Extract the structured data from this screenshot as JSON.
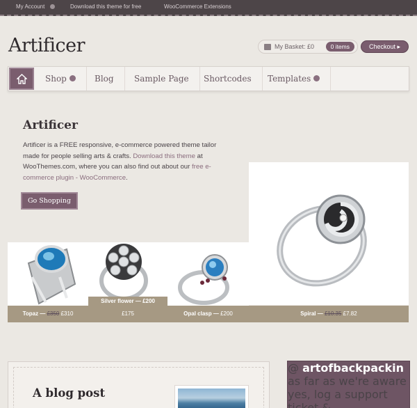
{
  "topbar": {
    "links": [
      "My Account",
      "Download this theme for free",
      "WooCommerce Extensions"
    ]
  },
  "header": {
    "site_title": "Artificer",
    "basket_label": "My Basket: £0",
    "basket_items": "0 items",
    "checkout_label": "Checkout ▸"
  },
  "nav": {
    "items": [
      {
        "label": "Shop",
        "dropdown": true
      },
      {
        "label": "Blog",
        "dropdown": false
      },
      {
        "label": "Sample Page",
        "dropdown": false
      },
      {
        "label": "Shortcodes",
        "dropdown": false
      },
      {
        "label": "Templates",
        "dropdown": true
      }
    ]
  },
  "feature": {
    "title": "Artificer",
    "text_1": "Artificer is a FREE responsive, e-commerce powered theme tailor made for people selling arts & crafts. ",
    "link_1": "Download this theme",
    "text_2": " at WooThemes.com, where you can also find out about our ",
    "link_2": "free e-commerce plugin - WooCommerce",
    "text_3": ".",
    "button": "Go Shopping"
  },
  "products": [
    {
      "name": "Topaz",
      "old_price": "£350",
      "price": "£310"
    },
    {
      "name": "Silver flower",
      "old_price": "£200",
      "price": "£175"
    },
    {
      "name": "Opal clasp",
      "old_price": "",
      "price": "£200"
    },
    {
      "name": "Spiral",
      "old_price": "£10.35",
      "price": "£7.82"
    }
  ],
  "blog": {
    "title": "A blog post"
  },
  "twitter": {
    "handle": "artofbackpackin",
    "text": " as far as we're aware yes, log a support ticket &"
  },
  "colors": {
    "accent": "#7a5d6e",
    "bar": "#a69983",
    "topbar": "#4d4548",
    "page_bg": "#ebe8e3"
  }
}
